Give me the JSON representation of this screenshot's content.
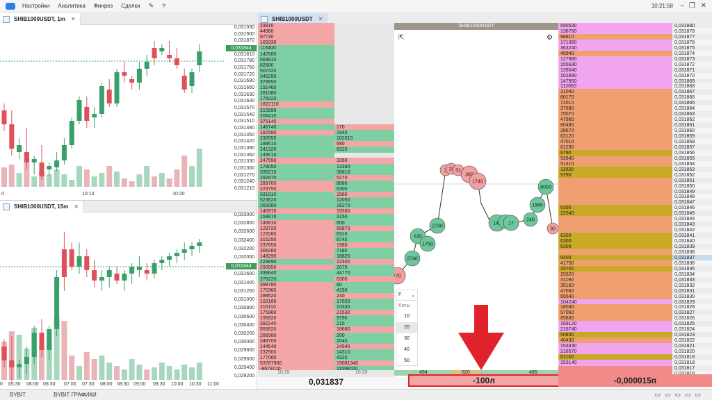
{
  "menu": {
    "items": [
      "Настройки",
      "Аналитика",
      "Финрез",
      "Сделки"
    ],
    "clock": "10:21:58",
    "icons": [
      "pin-icon",
      "help-icon"
    ]
  },
  "chart_1m": {
    "tab_label": "SHIB1000USDT, 1m",
    "current_price": "0,031844",
    "y_ticks": [
      "0,031930",
      "0,031900",
      "0,031870",
      "0,031844",
      "0,031810",
      "0,031780",
      "0,031750",
      "0,031720",
      "0,031690",
      "0,031660",
      "0,031630",
      "0,031600",
      "0,031570",
      "0,031540",
      "0,031510",
      "0,031480",
      "0,031450",
      "0,031420",
      "0,031390",
      "0,031360",
      "0,031330",
      "0,031300",
      "0,031270",
      "0,031240",
      "0,031210"
    ],
    "x_ticks": [
      "0",
      "10:10",
      "10:20"
    ]
  },
  "chart_15m": {
    "tab_label": "SHIB1000USDT, 15m",
    "current_price": "0,031844",
    "y_ticks": [
      "0,033000",
      "0,032800",
      "0,032600",
      "0,032400",
      "0,032200",
      "0,032000",
      "0,031844",
      "0,031600",
      "0,031400",
      "0,031200",
      "0,031000",
      "0,030800",
      "0,030600",
      "0,030400",
      "0,030200",
      "0,030000",
      "0,029800",
      "0,029600",
      "0,029400",
      "0,029200"
    ],
    "x_ticks": [
      "0",
      "05:30",
      "06:00",
      "06:30",
      "07:00",
      "07:30",
      "08:00",
      "08:30",
      "09:00",
      "09:30",
      "10:00",
      "10:30",
      "11:00"
    ]
  },
  "dom": {
    "tab_label": "SHIB1000USDT",
    "cluster_title": "SHIB1000USDT",
    "left_volumes": [
      [
        "23810",
        "sell",
        ""
      ],
      [
        "44960",
        "sell",
        ""
      ],
      [
        "97730",
        "sell",
        ""
      ],
      [
        "169330",
        "sell",
        ""
      ],
      [
        "116400",
        "buy",
        ""
      ],
      [
        "142580",
        "buy",
        ""
      ],
      [
        "569810",
        "buy",
        ""
      ],
      [
        "82800",
        "buy",
        ""
      ],
      [
        "507420",
        "buy",
        ""
      ],
      [
        "345290",
        "buy",
        ""
      ],
      [
        "378850",
        "buy",
        ""
      ],
      [
        "191460",
        "buy",
        ""
      ],
      [
        "281080",
        "buy",
        ""
      ],
      [
        "176020",
        "buy",
        ""
      ],
      [
        "1822110",
        "sell",
        ""
      ],
      [
        "210990",
        "buy",
        ""
      ],
      [
        "206410",
        "buy",
        ""
      ],
      [
        "375140",
        "sell",
        ""
      ],
      [
        "146740",
        "buy",
        "170"
      ],
      [
        "182580",
        "sell",
        "1940"
      ],
      [
        "230950",
        "buy",
        "102010"
      ],
      [
        "188610",
        "buy",
        "680"
      ],
      [
        "241320",
        "buy",
        "6320"
      ],
      [
        "149610",
        "buy",
        ""
      ],
      [
        "247590",
        "sell",
        "3260"
      ],
      [
        "178050",
        "buy",
        "13380"
      ],
      [
        "335210",
        "buy",
        "38610"
      ],
      [
        "292970",
        "buy",
        "5270"
      ],
      [
        "289700",
        "sell",
        "8080"
      ],
      [
        "223750",
        "sell",
        "6300"
      ],
      [
        "331910",
        "buy",
        "1560"
      ],
      [
        "523620",
        "buy",
        "12050"
      ],
      [
        "260080",
        "buy",
        "16270"
      ],
      [
        "140970",
        "sell",
        "19360"
      ],
      [
        "158870",
        "buy",
        "3150"
      ],
      [
        "146810",
        "sell",
        "800"
      ],
      [
        "129720",
        "sell",
        "60870"
      ],
      [
        "123260",
        "sell",
        "6310"
      ],
      [
        "315290",
        "sell",
        "8740"
      ],
      [
        "237650",
        "sell",
        "1980"
      ],
      [
        "306260",
        "sell",
        "7180"
      ],
      [
        "148290",
        "sell",
        "18820"
      ],
      [
        "229890",
        "buy",
        "22300"
      ],
      [
        "290550",
        "sell",
        "2070"
      ],
      [
        "338640",
        "buy",
        "44770"
      ],
      [
        "276220",
        "buy",
        "6300"
      ],
      [
        "398780",
        "sell",
        "80"
      ],
      [
        "170360",
        "sell",
        "4190"
      ],
      [
        "289520",
        "sell",
        "240"
      ],
      [
        "102160",
        "sell",
        "17020"
      ],
      [
        "216110",
        "sell",
        "23330"
      ],
      [
        "175960",
        "sell",
        "21530"
      ],
      [
        "195920",
        "sell",
        "9790"
      ],
      [
        "392240",
        "sell",
        "210"
      ],
      [
        "555620",
        "sell",
        "18680"
      ],
      [
        "286980",
        "sell",
        "200"
      ],
      [
        "348700",
        "sell",
        "2040"
      ],
      [
        "144540",
        "sell",
        "14540"
      ],
      [
        "232500",
        "sell",
        "14310"
      ],
      [
        "177060",
        "sell",
        "4320"
      ],
      [
        "53787900",
        "sell",
        "19081340"
      ],
      [
        "-8679120",
        "sell",
        "11598020"
      ]
    ],
    "left_time": "10:15",
    "left_time2": "10:20",
    "price_value": "0,031837",
    "lots_label": "Лоты",
    "lots_options": [
      "10",
      "20",
      "30",
      "40",
      "50"
    ],
    "filter_label": "F",
    "footer_vals": [
      "494",
      "620",
      "480"
    ],
    "position_value": "-100л",
    "pnl_value": "-0,000015п",
    "bubbles": [
      "3",
      "19",
      "51",
      "385",
      "1740",
      "8000",
      "1560",
      "240",
      "30",
      "144",
      "20",
      "17",
      "2730",
      "630",
      "1750",
      "2740",
      "770"
    ],
    "right_vol": [
      [
        "690530",
        "p"
      ],
      [
        "138760",
        "p"
      ],
      [
        "98810",
        "o"
      ],
      [
        "171360",
        "p"
      ],
      [
        "363240",
        "p"
      ],
      [
        "49940",
        "o"
      ],
      [
        "127980",
        "p"
      ],
      [
        "155630",
        "p"
      ],
      [
        "139040",
        "p"
      ],
      [
        "102890",
        "p"
      ],
      [
        "147950",
        "p"
      ],
      [
        "112050",
        "p"
      ],
      [
        "31040",
        "o"
      ],
      [
        "80170",
        "o"
      ],
      [
        "72010",
        "o"
      ],
      [
        "37680",
        "o"
      ],
      [
        "75070",
        "o"
      ],
      [
        "47960",
        "o"
      ],
      [
        "80480",
        "o"
      ],
      [
        "28670",
        "o"
      ],
      [
        "63120",
        "o"
      ],
      [
        "47010",
        "o"
      ],
      [
        "61290",
        "o"
      ],
      [
        "9790",
        "y"
      ],
      [
        "52640",
        "o"
      ],
      [
        "51410",
        "o"
      ],
      [
        "11930",
        "y"
      ],
      [
        "9790",
        "y"
      ],
      [
        "",
        "o"
      ],
      [
        "",
        "o"
      ],
      [
        "",
        "o"
      ],
      [
        "",
        "o"
      ],
      [
        "",
        "o"
      ],
      [
        "6300",
        "y"
      ],
      [
        "22540",
        "y"
      ],
      [
        "",
        "o"
      ],
      [
        "",
        "o"
      ],
      [
        "",
        "o"
      ],
      [
        "6300",
        "y"
      ],
      [
        "6300",
        "y"
      ],
      [
        "6300",
        "y"
      ],
      [
        "",
        "o"
      ],
      [
        "6400",
        "y"
      ],
      [
        "41750",
        "o"
      ],
      [
        "15700",
        "y"
      ],
      [
        "25520",
        "o"
      ],
      [
        "31190",
        "o"
      ],
      [
        "35160",
        "o"
      ],
      [
        "47060",
        "o"
      ],
      [
        "65540",
        "o"
      ],
      [
        "104240",
        "p"
      ],
      [
        "18040",
        "o"
      ],
      [
        "97060",
        "o"
      ],
      [
        "85630",
        "o"
      ],
      [
        "169120",
        "p"
      ],
      [
        "216740",
        "p"
      ],
      [
        "50830",
        "y"
      ],
      [
        "40430",
        "o"
      ],
      [
        "153430",
        "p"
      ],
      [
        "216570",
        "p"
      ],
      [
        "61130",
        "y"
      ],
      [
        "153140",
        "p"
      ]
    ],
    "right_prices": [
      "0,031880",
      "0,031878",
      "0,031877",
      "0,031876",
      "0,031875",
      "0,031874",
      "0,031873",
      "0,031872",
      "0,031871",
      "0,031870",
      "0,031869",
      "0,031868",
      "0,031867",
      "0,031866",
      "0,031865",
      "0,031864",
      "0,031863",
      "0,031862",
      "0,031861",
      "0,031860",
      "0,031859",
      "0,031858",
      "0,031857",
      "0,031856",
      "0,031855",
      "0,031854",
      "0,031853",
      "0,031852",
      "0,031851",
      "0,031850",
      "0,031849",
      "0,031848",
      "0,031847",
      "0,031846",
      "0,031845",
      "0,031844",
      "0,031843",
      "0,031842",
      "0,031841",
      "0,031840",
      "0,031839",
      "0,031838",
      "0,031837",
      "0,031836",
      "0,031835",
      "0,031834",
      "0,031833",
      "0,031832",
      "0,031831",
      "0,031830",
      "0,031829",
      "0,031828",
      "0,031827",
      "0,031826",
      "0,031825",
      "0,031824",
      "0,031823",
      "0,031822",
      "0,031821",
      "0,031820",
      "0,031819",
      "0,031818",
      "0,031817",
      "0,031816"
    ]
  },
  "status": {
    "tabs": [
      "BYBIT",
      "BYBIT ГРАФИКИ"
    ]
  },
  "colors": {
    "bull": "#3aa06a",
    "bear": "#e0505a",
    "arrow": "#e0232a"
  }
}
